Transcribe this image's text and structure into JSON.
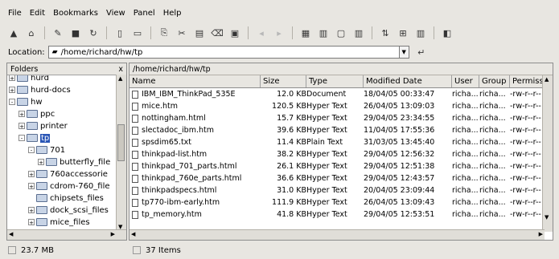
{
  "menu": [
    "File",
    "Edit",
    "Bookmarks",
    "View",
    "Panel",
    "Help"
  ],
  "toolbar_icons": [
    "up-icon",
    "home-icon",
    "bookmark-icon",
    "stop-icon",
    "reload-icon",
    "new-file-icon",
    "new-folder-icon",
    "copy-icon",
    "cut-icon",
    "paste-icon",
    "delete-icon",
    "properties-icon",
    "back-icon",
    "forward-icon",
    "view-icon-list-icon",
    "view-details-icon",
    "view-tree-icon",
    "view-columns-icon",
    "sort-icon",
    "grid-icon",
    "columns-icon",
    "terminal-icon"
  ],
  "location": {
    "label": "Location:",
    "value": "/home/richard/hw/tp"
  },
  "left_panel": {
    "title": "Folders",
    "close": "x",
    "tree": [
      {
        "label": "hurd",
        "expander": "+"
      },
      {
        "label": "hurd-docs",
        "expander": "+"
      },
      {
        "label": "hw",
        "expander": "-"
      },
      {
        "label": "ppc",
        "expander": "+"
      },
      {
        "label": "printer",
        "expander": "+"
      },
      {
        "label": "tp",
        "expander": "-"
      },
      {
        "label": "701",
        "expander": "-"
      },
      {
        "label": "butterfly_file",
        "expander": "+"
      },
      {
        "label": "760accessorie",
        "expander": "+"
      },
      {
        "label": "cdrom-760_file",
        "expander": "+"
      },
      {
        "label": "chipsets_files",
        "expander": ""
      },
      {
        "label": "dock_scsi_files",
        "expander": "+"
      },
      {
        "label": "mice_files",
        "expander": "+"
      }
    ]
  },
  "right_panel": {
    "path": "/home/richard/hw/tp",
    "columns": [
      "Name",
      "Size",
      "Type",
      "Modified Date",
      "User",
      "Group",
      "Permissions"
    ],
    "files": [
      {
        "name": "IBM_IBM_ThinkPad_535E",
        "size": "12.0 KB",
        "type": "Document",
        "date": "18/04/05 00:33:47",
        "user": "richa...",
        "group": "richa...",
        "perm": "-rw-r--r--"
      },
      {
        "name": "mice.htm",
        "size": "120.5 KB",
        "type": "Hyper Text",
        "date": "26/04/05 13:09:03",
        "user": "richa...",
        "group": "richa...",
        "perm": "-rw-r--r--"
      },
      {
        "name": "nottingham.html",
        "size": "15.7 KB",
        "type": "Hyper Text",
        "date": "29/04/05 23:34:55",
        "user": "richa...",
        "group": "richa...",
        "perm": "-rw-r--r--"
      },
      {
        "name": "slectadoc_ibm.htm",
        "size": "39.6 KB",
        "type": "Hyper Text",
        "date": "11/04/05 17:55:36",
        "user": "richa...",
        "group": "richa...",
        "perm": "-rw-r--r--"
      },
      {
        "name": "spsdim65.txt",
        "size": "11.4 KB",
        "type": "Plain Text",
        "date": "31/03/05 13:45:40",
        "user": "richa...",
        "group": "richa...",
        "perm": "-rw-r--r--"
      },
      {
        "name": "thinkpad-list.htm",
        "size": "38.2 KB",
        "type": "Hyper Text",
        "date": "29/04/05 12:56:32",
        "user": "richa...",
        "group": "richa...",
        "perm": "-rw-r--r--"
      },
      {
        "name": "thinkpad_701_parts.html",
        "size": "26.1 KB",
        "type": "Hyper Text",
        "date": "29/04/05 12:51:38",
        "user": "richa...",
        "group": "richa...",
        "perm": "-rw-r--r--"
      },
      {
        "name": "thinkpad_760e_parts.html",
        "size": "36.6 KB",
        "type": "Hyper Text",
        "date": "29/04/05 12:43:57",
        "user": "richa...",
        "group": "richa...",
        "perm": "-rw-r--r--"
      },
      {
        "name": "thinkpadspecs.html",
        "size": "31.0 KB",
        "type": "Hyper Text",
        "date": "20/04/05 23:09:44",
        "user": "richa...",
        "group": "richa...",
        "perm": "-rw-r--r--"
      },
      {
        "name": "tp770-ibm-early.htm",
        "size": "111.9 KB",
        "type": "Hyper Text",
        "date": "26/04/05 13:09:43",
        "user": "richa...",
        "group": "richa...",
        "perm": "-rw-r--r--"
      },
      {
        "name": "tp_memory.htm",
        "size": "41.8 KB",
        "type": "Hyper Text",
        "date": "29/04/05 12:53:51",
        "user": "richa...",
        "group": "richa...",
        "perm": "-rw-r--r--"
      }
    ]
  },
  "status": {
    "left": "23.7 MB",
    "right": "37 Items"
  },
  "colors": {
    "selection": "#2a56b6",
    "background": "#e8e6e1"
  }
}
